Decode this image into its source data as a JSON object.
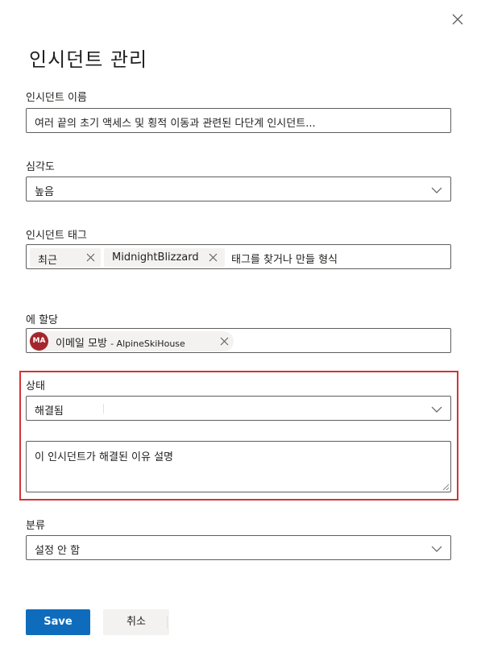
{
  "panel": {
    "title": "인시던트 관리",
    "close_icon": "close-icon"
  },
  "incident_name": {
    "label": "인시던트 이름",
    "value": "여러 끝의 초기 액세스 및 횡적 이동과 관련된 다단계 인시던트..."
  },
  "severity": {
    "label": "심각도",
    "value": "높음"
  },
  "tags": {
    "label": "인시던트 태그",
    "items": [
      {
        "label": "최근"
      },
      {
        "label": "MidnightBlizzard"
      }
    ],
    "placeholder": "태그를 찾거나 만들 형식"
  },
  "assign": {
    "label": "에 할당",
    "persona": {
      "initials": "MA",
      "name": "이메일 모방",
      "org": "- AlpineSkiHouse",
      "avatar_color": "#a4262c"
    }
  },
  "status": {
    "label": "상태",
    "value": "해결됨",
    "comment_placeholder": "이 인시던트가 해결된 이유 설명",
    "highlight_color": "#d13438"
  },
  "classification": {
    "label": "분류",
    "value": "설정 안 함"
  },
  "footer": {
    "save_label": "Save",
    "cancel_label": "취소",
    "primary_color": "#0f6cbd"
  }
}
